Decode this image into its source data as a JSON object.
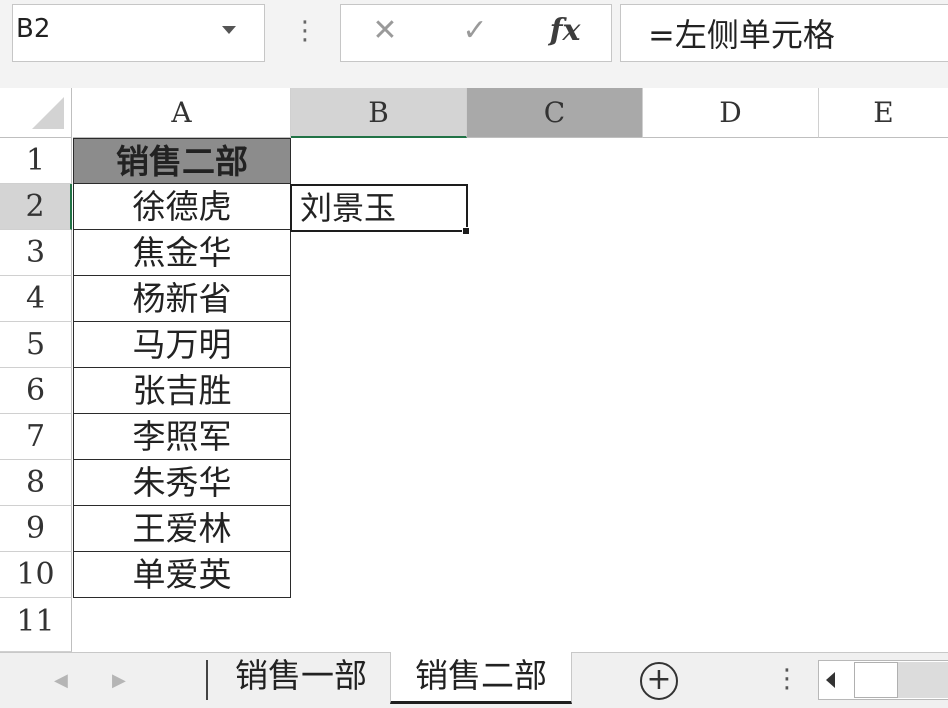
{
  "formula_bar": {
    "name_box": "B2",
    "more_icon": "⋮",
    "cancel_icon": "✕",
    "enter_icon": "✓",
    "fx_icon": "fx",
    "formula": "=左侧单元格"
  },
  "columns": [
    "A",
    "B",
    "C",
    "D",
    "E"
  ],
  "rows": [
    "1",
    "2",
    "3",
    "4",
    "5",
    "6",
    "7",
    "8",
    "9",
    "10",
    "11"
  ],
  "cells": {
    "A1": "销售二部",
    "A2": "徐德虎",
    "A3": "焦金华",
    "A4": "杨新省",
    "A5": "马万明",
    "A6": "张吉胜",
    "A7": "李照军",
    "A8": "朱秀华",
    "A9": "王爱林",
    "A10": "单爱英",
    "B2": "刘景玉"
  },
  "sheet_tabs": [
    "销售一部",
    "销售二部"
  ],
  "active_sheet": "销售二部",
  "tab_bar": {
    "prev_icon": "◀",
    "next_icon": "▶",
    "add_icon": "+",
    "more_icon": "⋮"
  },
  "colors": {
    "header_fill": "#8c8c8c",
    "selected_header": "#d4d4d4",
    "selection_border": "#1d1d1d"
  }
}
